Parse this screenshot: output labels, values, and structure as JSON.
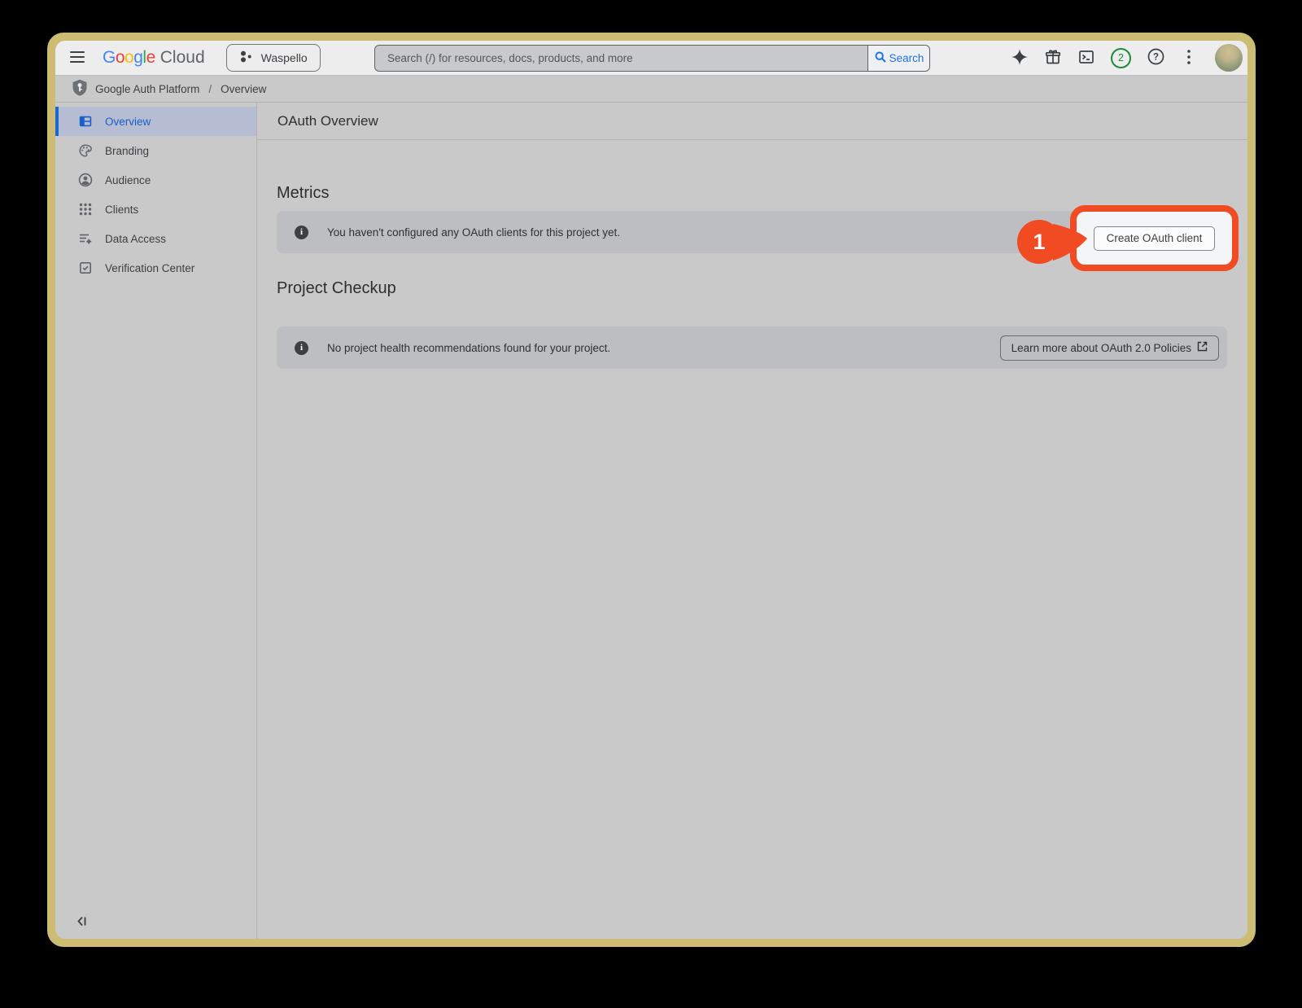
{
  "colors": {
    "accent_blue": "#1a73e8",
    "selected_blue": "#1a5fc8",
    "highlight_orange": "#f04b22",
    "frame_tan": "#cdbc74",
    "notification_green": "#1b8a3c",
    "infobar_gray": "#bcbec1"
  },
  "topbar": {
    "logo": {
      "letters": [
        "G",
        "o",
        "o",
        "g",
        "l",
        "e"
      ],
      "suffix": "Cloud"
    },
    "project_selector_label": "Waspello",
    "search_placeholder": "Search (/) for resources, docs, products, and more",
    "search_button_label": "Search",
    "notification_count": "2"
  },
  "breadcrumb": {
    "product": "Google Auth Platform",
    "separator": "/",
    "page": "Overview"
  },
  "sidebar": {
    "items": [
      {
        "label": "Overview",
        "selected": true
      },
      {
        "label": "Branding",
        "selected": false
      },
      {
        "label": "Audience",
        "selected": false
      },
      {
        "label": "Clients",
        "selected": false
      },
      {
        "label": "Data Access",
        "selected": false
      },
      {
        "label": "Verification Center",
        "selected": false
      }
    ]
  },
  "content": {
    "page_title": "OAuth Overview",
    "metrics": {
      "heading": "Metrics",
      "info_text": "You haven't configured any OAuth clients for this project yet.",
      "action_label": "Create OAuth client"
    },
    "project_checkup": {
      "heading": "Project Checkup",
      "info_text": "No project health recommendations found for your project.",
      "action_label": "Learn more about OAuth 2.0 Policies"
    }
  },
  "annotation": {
    "step_number": "1"
  }
}
